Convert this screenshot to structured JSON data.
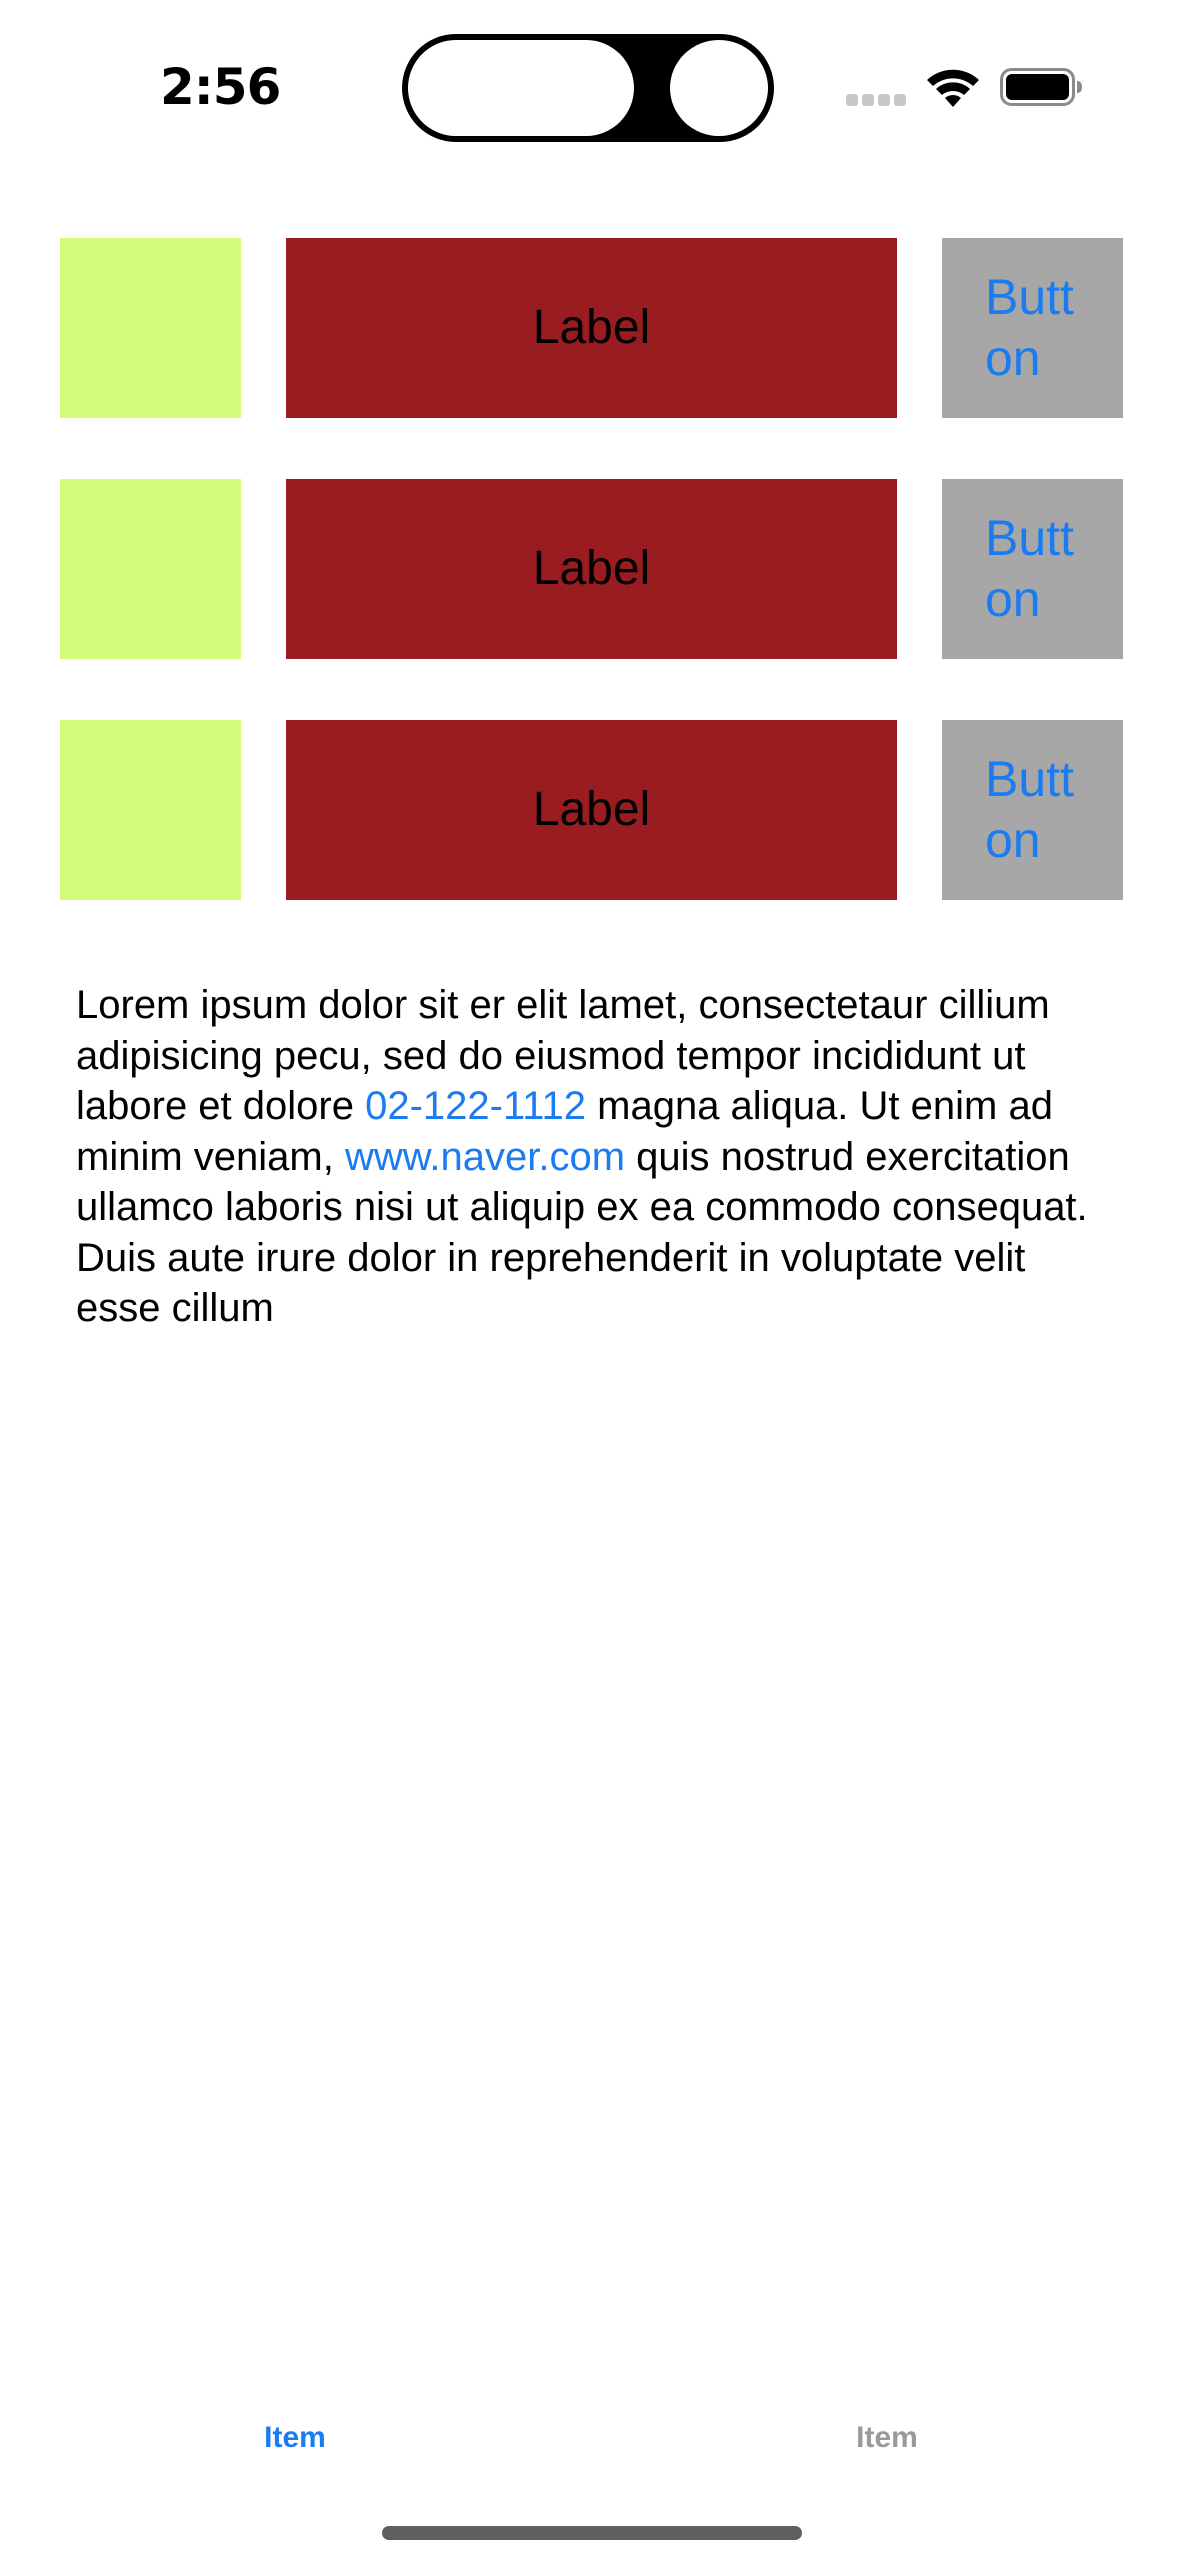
{
  "status_bar": {
    "time": "2:56"
  },
  "rows": [
    {
      "label": "Label",
      "button_lines": [
        "Butt",
        "on"
      ]
    },
    {
      "label": "Label",
      "button_lines": [
        "Butt",
        "on"
      ]
    },
    {
      "label": "Label",
      "button_lines": [
        "Butt",
        "on"
      ]
    }
  ],
  "text_view": {
    "part_1": "Lorem ipsum dolor sit er elit lamet, consectetaur cillium adipisicing pecu, sed do eiusmod tempor incididunt ut labore et dolore ",
    "phone_link": "02-122-1112",
    "part_2": " magna aliqua. Ut enim ad minim veniam, ",
    "url_link": "www.naver.com",
    "part_3": " quis nostrud exercitation ullamco laboris nisi ut aliquip ex ea commodo consequat. Duis aute irure dolor in reprehenderit in voluptate velit esse cillum"
  },
  "tab_bar": {
    "items": [
      {
        "label": "Item",
        "selected": true
      },
      {
        "label": "Item",
        "selected": false
      }
    ]
  },
  "colors": {
    "swatch": "#d5fb7b",
    "label_background": "#981c20",
    "button_background": "#a7a7a7",
    "accent": "#1a7cf0",
    "tab_inactive": "#9a9a9a"
  },
  "icons": [
    "signal-icon",
    "wifi-icon",
    "battery-icon"
  ]
}
